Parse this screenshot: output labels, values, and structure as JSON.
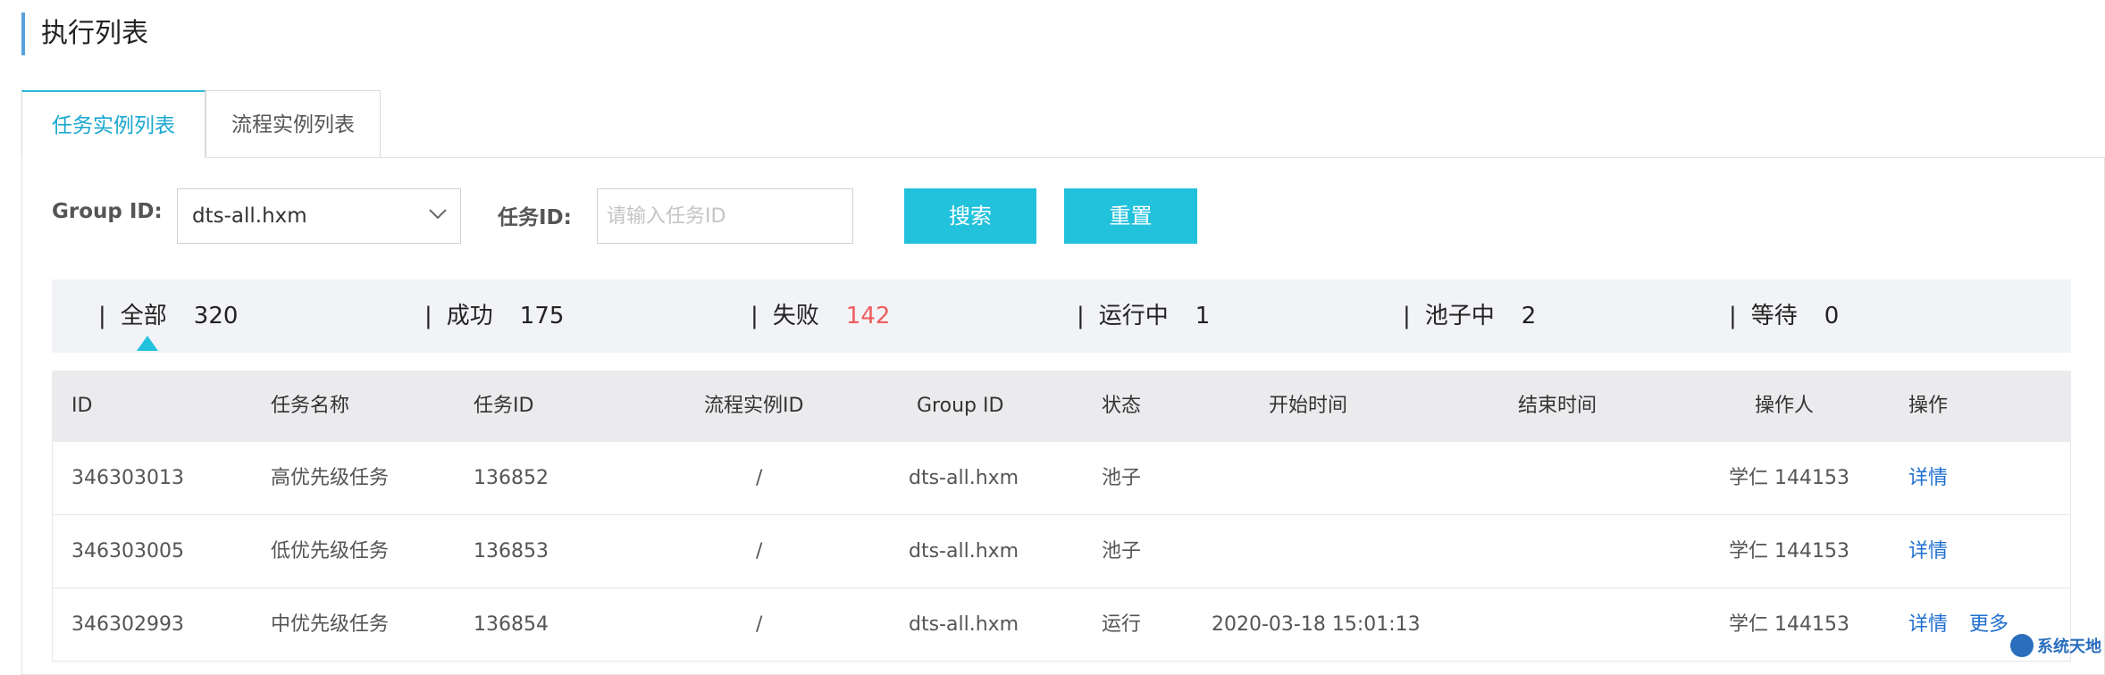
{
  "page_title": "执行列表",
  "tabs": [
    {
      "label": "任务实例列表",
      "active": true
    },
    {
      "label": "流程实例列表",
      "active": false
    }
  ],
  "filters": {
    "group_label": "Group ID:",
    "group_value": "dts-all.hxm",
    "task_label": "任务ID:",
    "task_placeholder": "请输入任务ID",
    "search_button": "搜索",
    "reset_button": "重置"
  },
  "stats": [
    {
      "separator": "|",
      "label": "全部",
      "count": "320"
    },
    {
      "separator": "|",
      "label": "成功",
      "count": "175"
    },
    {
      "separator": "|",
      "label": "失败",
      "count": "142"
    },
    {
      "separator": "|",
      "label": "运行中",
      "count": "1"
    },
    {
      "separator": "|",
      "label": "池子中",
      "count": "2"
    },
    {
      "separator": "|",
      "label": "等待",
      "count": "0"
    }
  ],
  "table": {
    "headers": [
      "ID",
      "任务名称",
      "任务ID",
      "流程实例ID",
      "Group ID",
      "状态",
      "开始时间",
      "结束时间",
      "操作人",
      "操作"
    ],
    "rows": [
      {
        "id": "346303013",
        "name": "高优先级任务",
        "task_id": "136852",
        "flow_id": "/",
        "group_id": "dts-all.hxm",
        "status": "池子",
        "start": "",
        "end": "",
        "operator": "学仁 144153",
        "actions": [
          "详情"
        ]
      },
      {
        "id": "346303005",
        "name": "低优先级任务",
        "task_id": "136853",
        "flow_id": "/",
        "group_id": "dts-all.hxm",
        "status": "池子",
        "start": "",
        "end": "",
        "operator": "学仁 144153",
        "actions": [
          "详情"
        ]
      },
      {
        "id": "346302993",
        "name": "中优先级任务",
        "task_id": "136854",
        "flow_id": "/",
        "group_id": "dts-all.hxm",
        "status": "运行",
        "start": "2020-03-18 15:01:13",
        "end": "",
        "operator": "学仁 144153",
        "actions": [
          "详情",
          "更多"
        ]
      }
    ]
  },
  "watermark": "系统天地",
  "colors": {
    "accent": "#22c1dc",
    "link": "#1f6fd0",
    "fail": "#f05d5d"
  }
}
